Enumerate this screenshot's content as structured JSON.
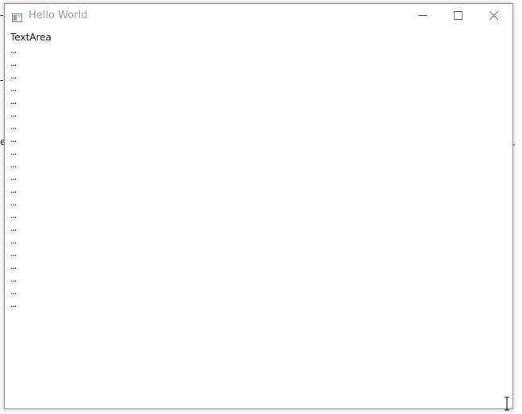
{
  "window": {
    "title": "Hello World",
    "icon": "app-window-icon",
    "controls": {
      "minimize_icon": "minimize-icon",
      "maximize_icon": "maximize-icon",
      "close_icon": "close-icon"
    }
  },
  "textarea": {
    "label": "TextArea",
    "lines": [
      "...",
      "...",
      "...",
      "...",
      "...",
      "...",
      "...",
      "...",
      "...",
      "...",
      "...",
      "...",
      "...",
      "...",
      "...",
      "...",
      "...",
      "...",
      "...",
      "...",
      "..."
    ]
  },
  "colors": {
    "title_text": "#999999",
    "border": "#8a8a8a",
    "background": "#ffffff"
  }
}
